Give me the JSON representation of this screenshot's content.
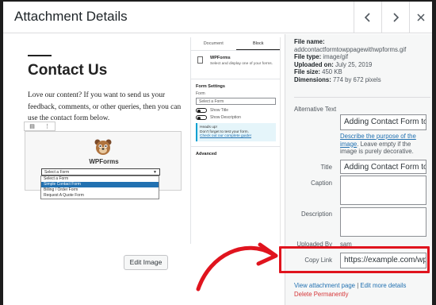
{
  "header": {
    "title": "Attachment Details",
    "prev_icon": "chevron-left-icon",
    "next_icon": "chevron-right-icon",
    "close_icon": "close-icon"
  },
  "preview": {
    "page_title": "Contact Us",
    "body_text": "Love our content? If you want to send us your feedback, comments, or other queries, then you can use the contact form below.",
    "wpforms_name": "WPForms",
    "select_value": "Select a Form",
    "dropdown_items": [
      "Select a Form",
      "Simple Contact Form",
      "Billing / Order Form",
      "Request A Quote Form"
    ],
    "selected_dropdown_index": 1,
    "sidebar": {
      "tab_document": "Document",
      "tab_block": "Block",
      "block_name": "WPForms",
      "block_desc": "Select and display one of your forms.",
      "form_settings": "Form Settings",
      "form_label": "Form",
      "form_select": "Select a Form",
      "show_title": "Show Title",
      "show_description": "Show Description",
      "notice_title": "Heads up!",
      "notice_text": "Don't forget to test your form.",
      "notice_link": "Check out our complete guide!",
      "advanced": "Advanced"
    }
  },
  "edit_image_label": "Edit Image",
  "details": {
    "file_name_label": "File name:",
    "file_name": "addcontactformtowppagewithwpforms.gif",
    "file_type_label": "File type:",
    "file_type": "image/gif",
    "uploaded_on_label": "Uploaded on:",
    "uploaded_on": "July 25, 2019",
    "file_size_label": "File size:",
    "file_size": "450 KB",
    "dimensions_label": "Dimensions:",
    "dimensions": "774 by 672 pixels"
  },
  "fields": {
    "alt_label": "Alternative Text",
    "alt_value": "Adding Contact Form to",
    "alt_help_link": "Describe the purpose of the image",
    "alt_help_rest": ". Leave empty if the image is purely decorative.",
    "title_label": "Title",
    "title_value": "Adding Contact Form to",
    "caption_label": "Caption",
    "caption_value": "",
    "description_label": "Description",
    "description_value": "",
    "uploaded_by_label": "Uploaded By",
    "uploaded_by_value": "sam",
    "copy_link_label": "Copy Link",
    "copy_link_value": "https://example.com/wp"
  },
  "links": {
    "view_attachment": "View attachment page",
    "separator": "|",
    "edit_details": "Edit more details",
    "delete": "Delete Permanently"
  },
  "colors": {
    "accent": "#2271b1",
    "highlight": "#e0141e",
    "delete": "#d63638"
  }
}
